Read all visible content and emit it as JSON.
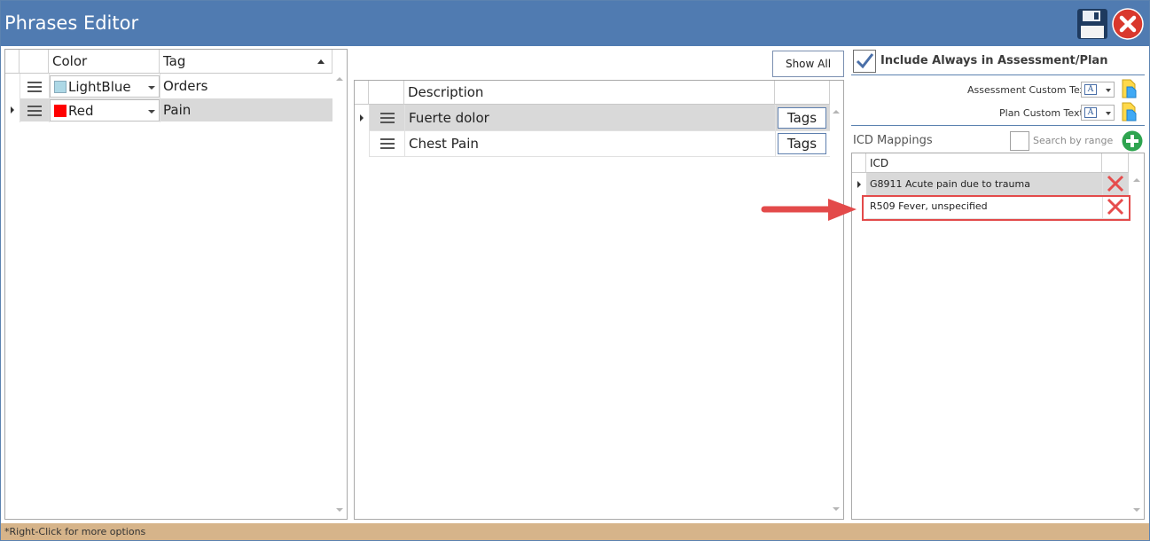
{
  "window": {
    "title": "Phrases Editor"
  },
  "left_grid": {
    "columns": [
      "Color",
      "Tag"
    ],
    "rows": [
      {
        "color_name": "LightBlue",
        "color_hex": "#add8e6",
        "tag": "Orders"
      },
      {
        "color_name": "Red",
        "color_hex": "#ff0000",
        "tag": "Pain"
      }
    ]
  },
  "middle": {
    "show_all_label": "Show All",
    "columns": [
      "Description"
    ],
    "rows": [
      {
        "description": "Fuerte dolor",
        "tags_label": "Tags"
      },
      {
        "description": "Chest Pain",
        "tags_label": "Tags"
      }
    ]
  },
  "right": {
    "include_always_label": "Include Always in Assessment/Plan",
    "include_always_checked": true,
    "assessment_custom_text_label": "Assessment Custom Text:",
    "plan_custom_text_label": "Plan Custom Text:",
    "icd_mappings_label": "ICD Mappings",
    "search_by_range_label": "Search by range",
    "icd_grid": {
      "columns": [
        "ICD"
      ],
      "rows": [
        {
          "text": "G8911 Acute pain due to trauma"
        },
        {
          "text": "R509 Fever, unspecified"
        }
      ]
    }
  },
  "status_bar": {
    "text": "*Right-Click for more options"
  },
  "colors": {
    "titlebar": "#507bb1",
    "status_bar": "#d6b48a",
    "annotation": "#e34a4a",
    "selected_row": "#d9d9d9"
  },
  "icons": {
    "save": "floppy-disk-icon",
    "close": "close-circle-icon",
    "add": "plus-circle-icon",
    "delete": "x-icon",
    "row_menu": "hamburger-icon",
    "paste": "paste-icon"
  }
}
